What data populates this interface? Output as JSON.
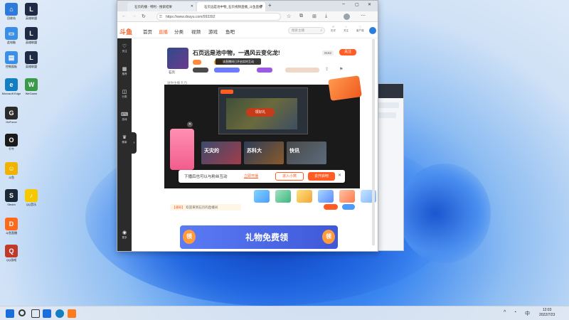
{
  "colors": {
    "accent": "#ff5d23",
    "desktop_blue": "#2f74e6",
    "sidebar": "#2b2b2b"
  },
  "desktop": {
    "icons": [
      {
        "label": "回收站",
        "color": "#2f7ad8",
        "glyph": "⌂",
        "icon": "recycle-bin-icon"
      },
      {
        "label": "英雄联盟",
        "color": "#1f2a44",
        "glyph": "L",
        "icon": "league-icon"
      },
      {
        "label": "此电脑",
        "color": "#3b8ee8",
        "glyph": "▭",
        "icon": "computer-icon"
      },
      {
        "label": "英雄联盟",
        "color": "#1f2a44",
        "glyph": "L",
        "icon": "league-icon"
      },
      {
        "label": "控制面板",
        "color": "#3b8ee8",
        "glyph": "▤",
        "icon": "control-panel-icon"
      },
      {
        "label": "英雄联盟",
        "color": "#1f2a44",
        "glyph": "L",
        "icon": "league-icon"
      },
      {
        "label": "Microsoft Edge",
        "color": "#137ec2",
        "glyph": "e",
        "icon": "edge-icon"
      },
      {
        "label": "WeGame",
        "color": "#3a9a4a",
        "glyph": "W",
        "icon": "wegame-icon"
      },
      {
        "label": "GeForce",
        "color": "#2b2b2b",
        "glyph": "G",
        "icon": "app-icon"
      },
      {
        "label": "千牛",
        "color": "#1a1a1a",
        "glyph": "O",
        "icon": "app-icon"
      },
      {
        "label": "斗鱼",
        "color": "#f0b400",
        "glyph": "☺",
        "icon": "douyu-app-icon"
      },
      {
        "label": "Steam",
        "color": "#1b2838",
        "glyph": "S",
        "icon": "steam-icon"
      },
      {
        "label": "QQ音乐",
        "color": "#f5c800",
        "glyph": "♪",
        "icon": "music-icon"
      },
      {
        "label": "斗鱼直播",
        "color": "#ff6a1a",
        "glyph": "D",
        "icon": "douyu-live-icon"
      },
      {
        "label": "QQ游戏",
        "color": "#c0392b",
        "glyph": "Q",
        "icon": "game-icon"
      }
    ]
  },
  "taskbar": {
    "time": "12:03",
    "date": "2022/7/23",
    "lang": "中"
  },
  "browser": {
    "tabs": [
      {
        "title": "石页的播 - 特利 - 搜索结果",
        "active": false
      },
      {
        "title": "石页远是池中物_石页视频直播_斗鱼直播",
        "active": true
      }
    ],
    "url": "https://www.douyu.com/993392",
    "nav": {
      "logo": "斗鱼",
      "items": [
        "首页",
        "直播",
        "分类",
        "视频",
        "游戏",
        "鱼吧"
      ],
      "search_placeholder": "搜索主播",
      "right_items": [
        "历史",
        "关注",
        "客户端"
      ]
    },
    "sidebar": [
      "关注",
      "推荐",
      "分类",
      "游戏",
      "赛事",
      "更多"
    ],
    "room": {
      "title": "石页远是池中物，一遇风云变化龙!",
      "streamer": "石页",
      "followers": "9162",
      "follow_label": "关注",
      "tooltip": "该直播间已开启实时互动",
      "subbar": "送你主播 礼包",
      "player_caption": "领好礼",
      "overlay_text": "下播后也可以与粉丝互动",
      "overlay_link": "立即开播",
      "overlay_btn1": "进入小窝",
      "overlay_btn2": "去开启吧",
      "video_title": "石页远是池中物",
      "cards": [
        "天灾的",
        "苏科大",
        "快讯"
      ],
      "chat_label": "【通知】",
      "chat_text": "欢迎来到石页的直播间",
      "banner_text": "礼物免费领",
      "banner_badge": "领"
    }
  }
}
